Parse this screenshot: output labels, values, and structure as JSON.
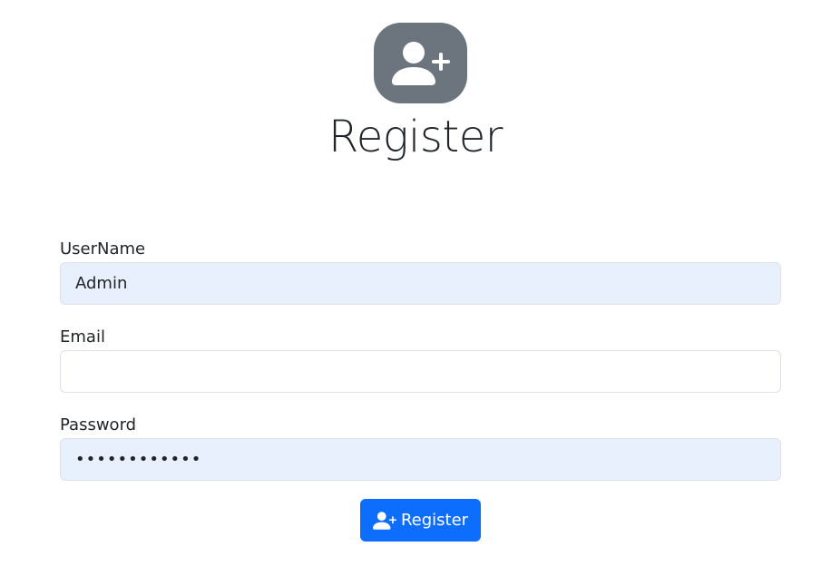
{
  "header": {
    "title": "Register",
    "logo_icon": "person-plus-icon"
  },
  "form": {
    "username": {
      "label": "UserName",
      "value": "Admin"
    },
    "email": {
      "label": "Email",
      "value": ""
    },
    "password": {
      "label": "Password",
      "value": "adminpass123"
    },
    "submit": {
      "label": "Register",
      "icon": "person-plus-icon"
    }
  },
  "colors": {
    "primary": "#0d6efd",
    "logo_background": "#6c757d",
    "autofill_background": "#e8f0fe",
    "border": "#dee2e6"
  }
}
